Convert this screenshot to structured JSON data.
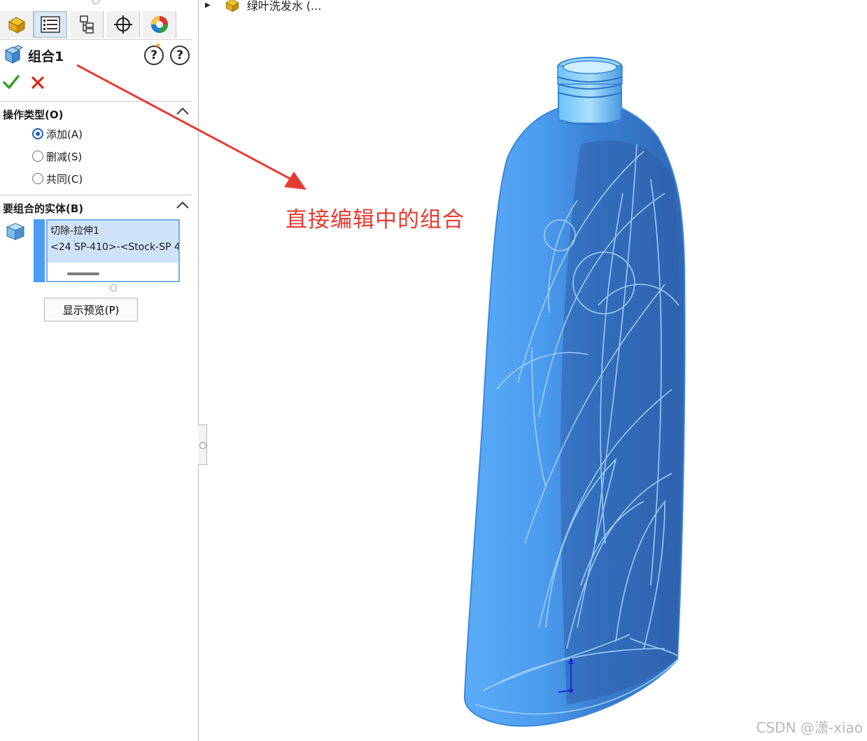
{
  "tabs": [
    {
      "name": "featuremanager-tab",
      "icon": "part-icon"
    },
    {
      "name": "propertymanager-tab",
      "icon": "property-list-icon"
    },
    {
      "name": "configurationmanager-tab",
      "icon": "configuration-icon"
    },
    {
      "name": "dimxpert-tab",
      "icon": "crosshair-icon"
    },
    {
      "name": "display-manager-tab",
      "icon": "appearance-sphere-icon"
    }
  ],
  "feature": {
    "title": "组合1",
    "icon": "combine-bodies-icon"
  },
  "operation_section": {
    "title": "操作类型(O)",
    "options": [
      {
        "label": "添加(A)",
        "checked": true
      },
      {
        "label": "删减(S)",
        "checked": false
      },
      {
        "label": "共同(C)",
        "checked": false
      }
    ]
  },
  "bodies_section": {
    "title": "要组合的实体(B)",
    "items": [
      "切除-拉伸1",
      "<24 SP-410>-<Stock-SP 4"
    ]
  },
  "preview_button": "显示预览(P)",
  "tree": {
    "item_label": "绿叶洗发水 (..."
  },
  "annotation": "直接编辑中的组合",
  "watermark": "CSDN @潇-xiao",
  "colors": {
    "accent": "#1c5fb5",
    "body_blue": "#4ea3f5",
    "annotation_red": "#e63b32",
    "check_green": "#3b9b2a",
    "cancel_red": "#d42a1c"
  }
}
